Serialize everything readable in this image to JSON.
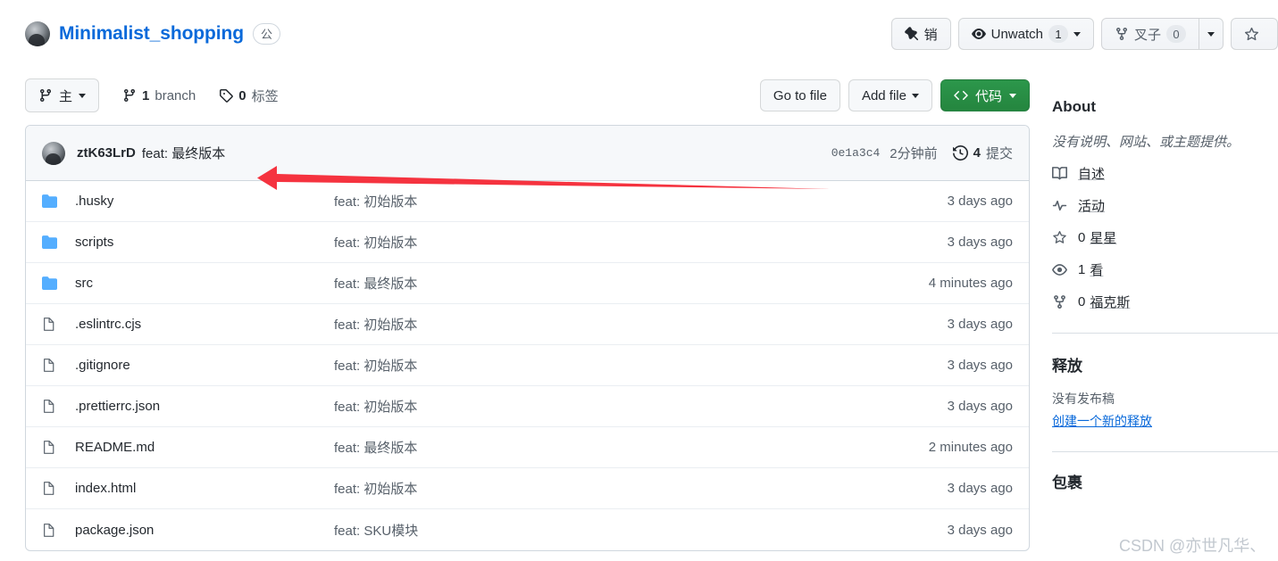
{
  "header": {
    "repo_name": "Minimalist_shopping",
    "visibility": "公",
    "avatar": "owner-avatar",
    "actions": {
      "pin_label": "销",
      "watch_label": "Unwatch",
      "watch_count": "1",
      "fork_label": "叉子",
      "fork_count": "0",
      "star_label": ""
    }
  },
  "toolbar": {
    "branch_name": "主",
    "branch_count_value": "1",
    "branch_count_label": "branch",
    "tag_count_value": "0",
    "tag_count_label": "标签",
    "go_to_file": "Go to file",
    "add_file": "Add file",
    "code_label": "代码"
  },
  "commit_bar": {
    "author": "ztK63LrD",
    "message": "feat: 最终版本",
    "sha": "0e1a3c4",
    "time": "2分钟前",
    "commit_count": "4",
    "commit_count_label": "提交"
  },
  "files": [
    {
      "type": "folder",
      "name": ".husky",
      "message": "feat: 初始版本",
      "time": "3 days ago"
    },
    {
      "type": "folder",
      "name": "scripts",
      "message": "feat: 初始版本",
      "time": "3 days ago"
    },
    {
      "type": "folder",
      "name": "src",
      "message": "feat: 最终版本",
      "time": "4 minutes ago"
    },
    {
      "type": "file",
      "name": ".eslintrc.cjs",
      "message": "feat: 初始版本",
      "time": "3 days ago"
    },
    {
      "type": "file",
      "name": ".gitignore",
      "message": "feat: 初始版本",
      "time": "3 days ago"
    },
    {
      "type": "file",
      "name": ".prettierrc.json",
      "message": "feat: 初始版本",
      "time": "3 days ago"
    },
    {
      "type": "file",
      "name": "README.md",
      "message": "feat: 最终版本",
      "time": "2 minutes ago"
    },
    {
      "type": "file",
      "name": "index.html",
      "message": "feat: 初始版本",
      "time": "3 days ago"
    },
    {
      "type": "file",
      "name": "package.json",
      "message": "feat: SKU模块",
      "time": "3 days ago"
    }
  ],
  "sidebar": {
    "about_title": "About",
    "description": "没有说明、网站、或主题提供。",
    "links": [
      {
        "icon": "book-icon",
        "label": "自述"
      },
      {
        "icon": "activity-icon",
        "label": "活动"
      }
    ],
    "stats": [
      {
        "icon": "star-icon",
        "value": "0",
        "label": "星星"
      },
      {
        "icon": "eye-icon",
        "value": "1",
        "label": "看"
      },
      {
        "icon": "fork-icon",
        "value": "0",
        "label": "福克斯"
      }
    ],
    "releases_title": "释放",
    "releases_empty": "没有发布稿",
    "releases_create": "创建一个新的释放",
    "packages_title": "包裹"
  },
  "watermark": "CSDN @亦世凡华、",
  "colors": {
    "link": "#0969da",
    "green": "#2c974b",
    "folder": "#54aeff",
    "muted": "#57606a",
    "border": "#d0d7de",
    "arrow": "#f5333f"
  }
}
